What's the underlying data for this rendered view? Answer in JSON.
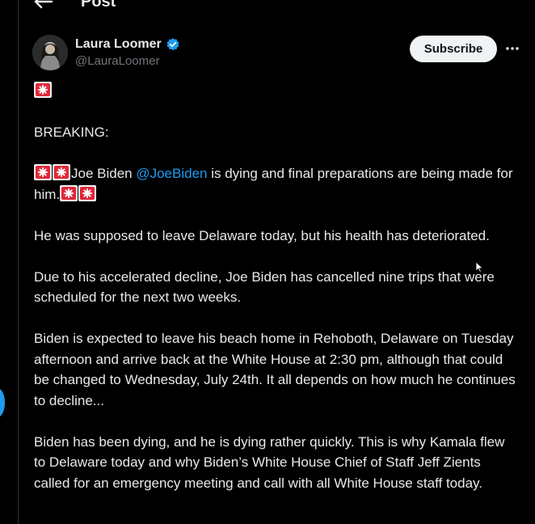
{
  "header": {
    "back_icon": "arrow-left-icon",
    "title": "Post"
  },
  "author": {
    "name": "Laura Loomer",
    "handle": "@LauraLoomer",
    "verified_icon": "verified-badge-icon",
    "verified_color": "#1d9bf0"
  },
  "actions": {
    "subscribe_label": "Subscribe",
    "more_icon": "more-horizontal-icon"
  },
  "post": {
    "siren_icon": "police-siren-emoji",
    "p1_label": "BREAKING:",
    "p2_before": "Joe Biden ",
    "p2_mention": "@JoeBiden",
    "p2_after": " is dying and final preparations are being made for him.",
    "p3": "He was supposed to leave Delaware today, but his health has deteriorated.",
    "p4": "Due to his accelerated decline, Joe Biden has cancelled nine trips that were scheduled for the next two weeks.",
    "p5": "Biden is expected to leave his beach home in Rehoboth, Delaware on Tuesday afternoon and arrive back at the White House at 2:30 pm, although that could be changed to Wednesday, July 24th. It all depends on how much he continues to decline...",
    "p6": "Biden has been dying, and he is dying rather quickly. This is why Kamala flew to Delaware today and why Biden’s White House Chief of Staff Jeff Zients called for an emergency meeting and call with all White House staff today."
  },
  "colors": {
    "background": "#000000",
    "text": "#e7e9ea",
    "secondary_text": "#71767b",
    "link": "#1d9bf0",
    "siren_red": "#e0283a"
  }
}
